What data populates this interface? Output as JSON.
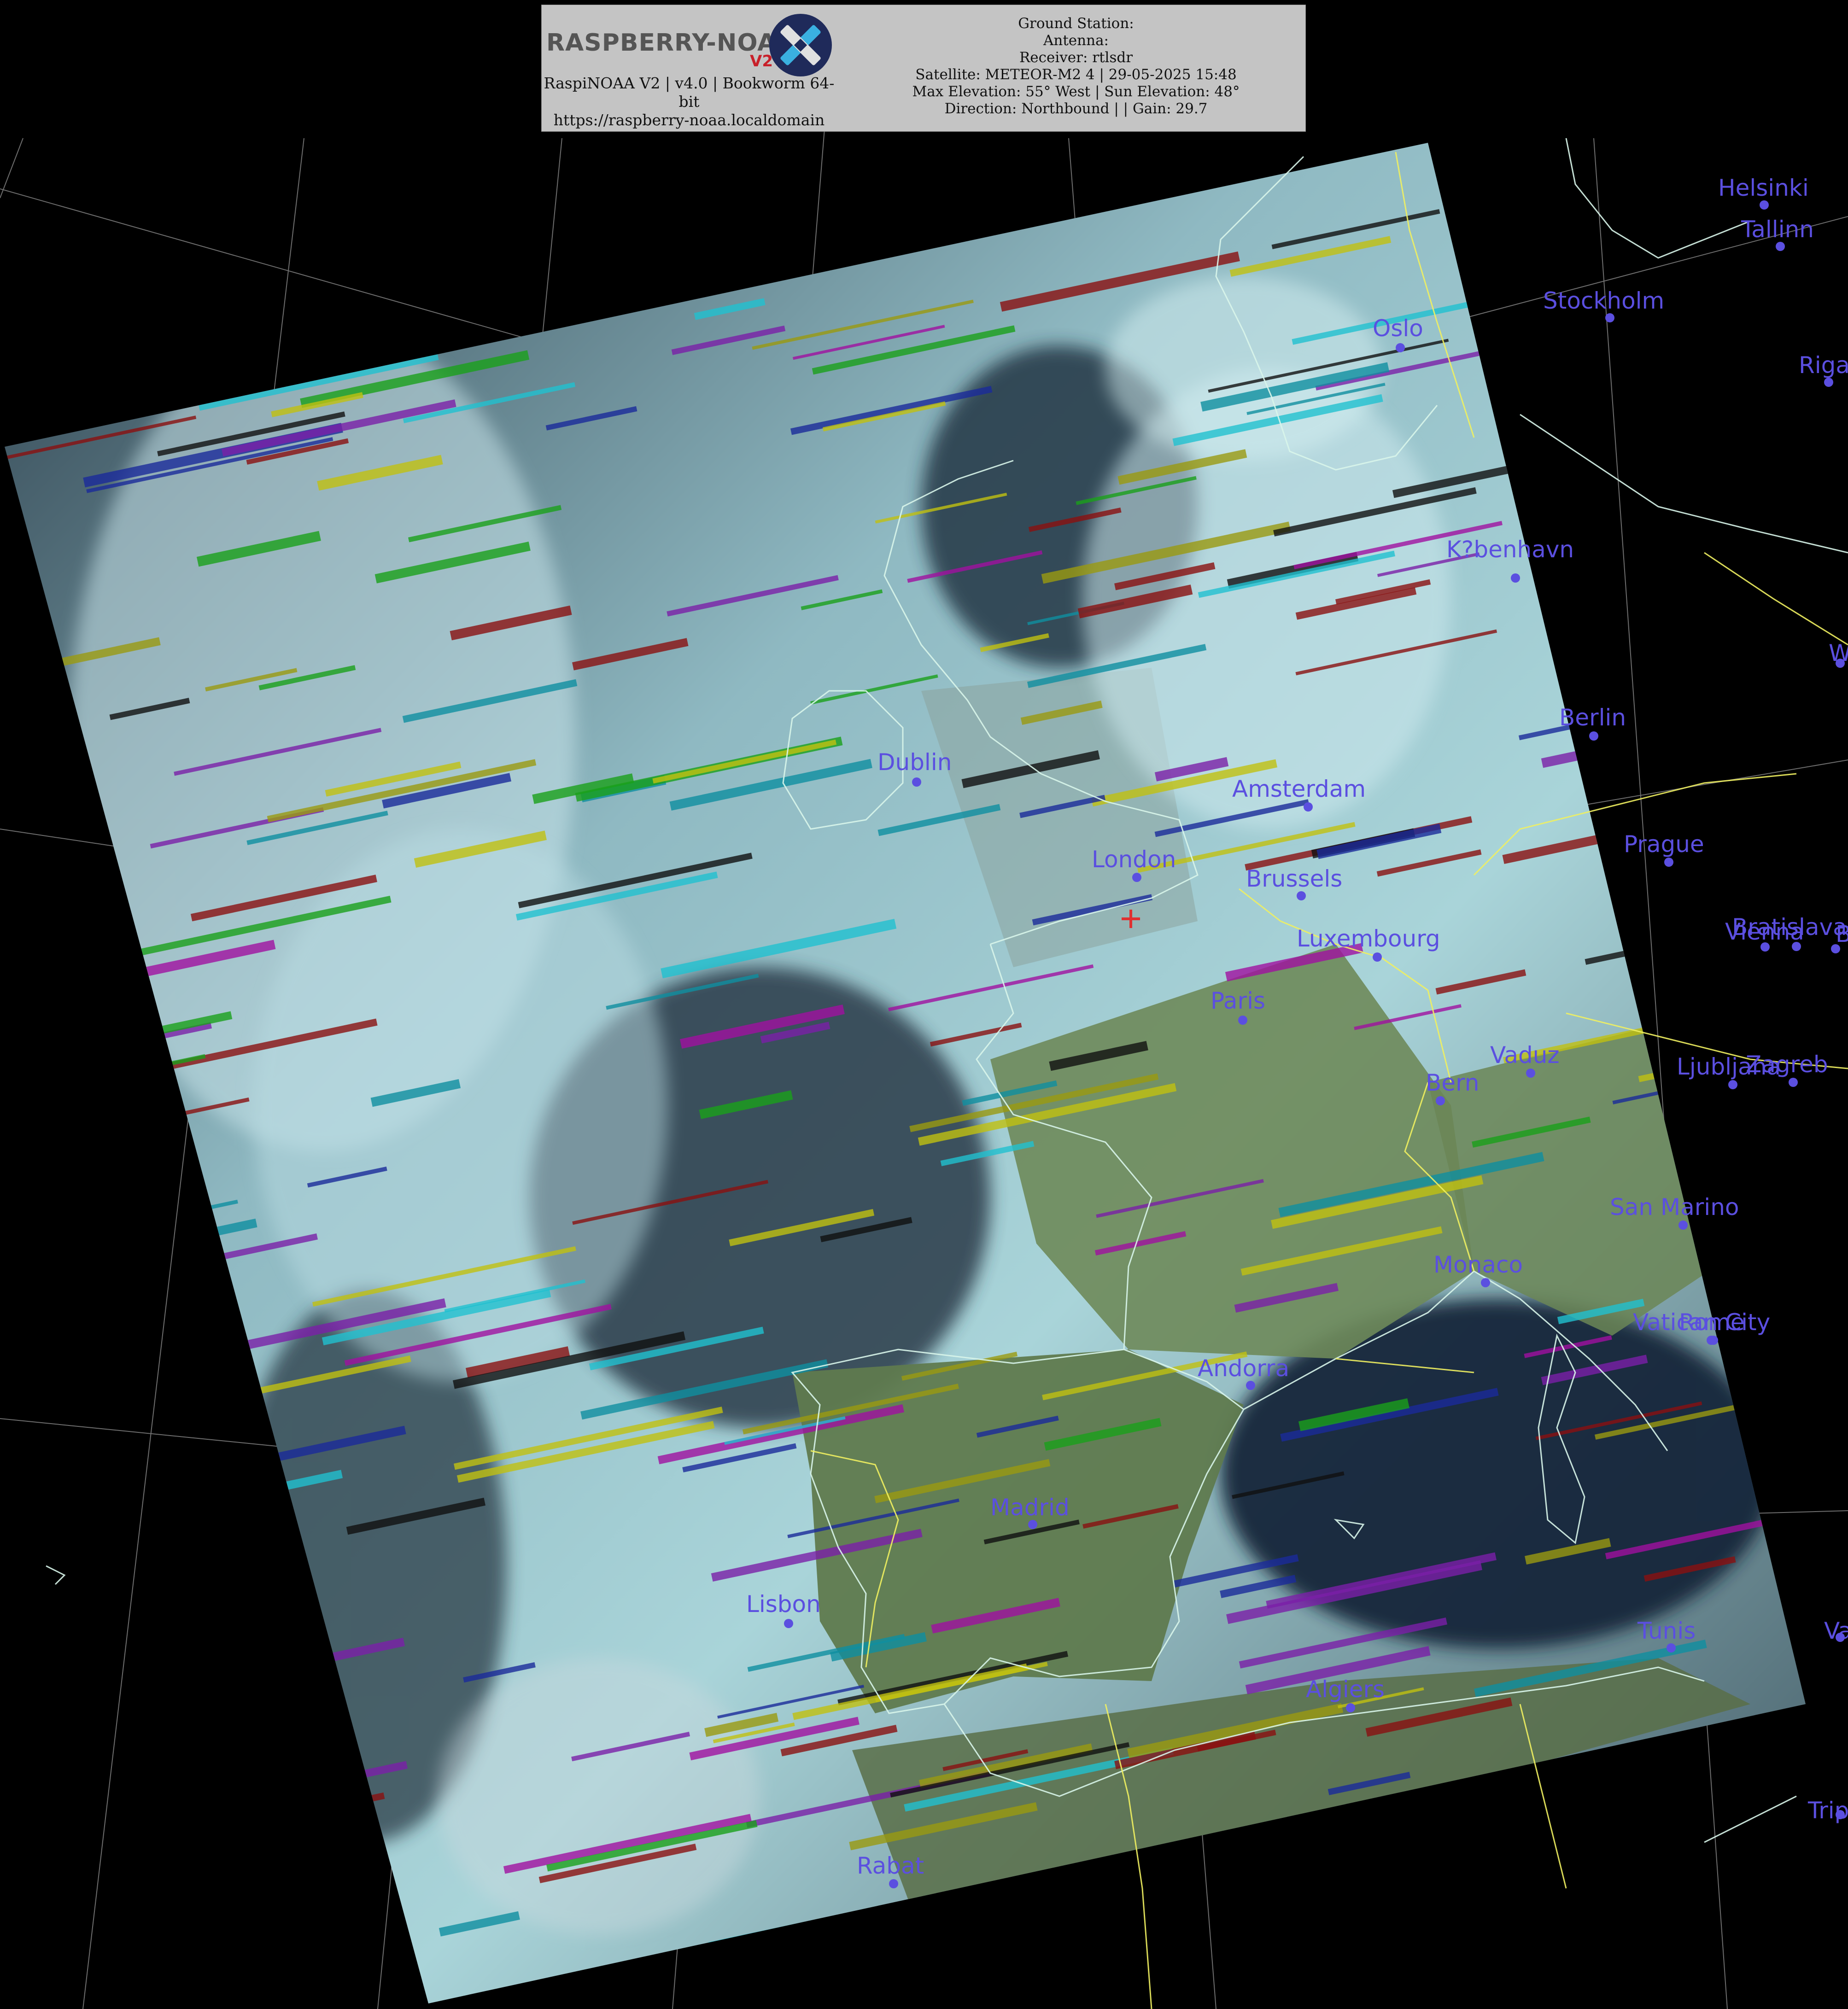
{
  "header": {
    "logo_text": "RASPBERRY-NOAA",
    "logo_v2": "V2",
    "left_lines": [
      "RaspiNOAA V2 | v4.0 | Bookworm 64-",
      "bit",
      "https://raspberry-noaa.localdomain"
    ],
    "right_lines": [
      "Ground Station:",
      "Antenna:",
      "Receiver: rtlsdr",
      "Satellite: METEOR-M2 4 | 29-05-2025 15:48",
      "Max Elevation: 55° West | Sun Elevation: 48°",
      "Direction: Northbound | | Gain: 29.7"
    ]
  },
  "cities": [
    {
      "name": "Helsinki"
    },
    {
      "name": "Tallinn"
    },
    {
      "name": "Stockholm"
    },
    {
      "name": "Oslo"
    },
    {
      "name": "Riga"
    },
    {
      "name": "K?benhavn"
    },
    {
      "name": "Warsaw"
    },
    {
      "name": "Berlin"
    },
    {
      "name": "Dublin"
    },
    {
      "name": "Amsterdam"
    },
    {
      "name": "London"
    },
    {
      "name": "Brussels"
    },
    {
      "name": "Prague"
    },
    {
      "name": "Luxembourg"
    },
    {
      "name": "Bratislava"
    },
    {
      "name": "Vienna"
    },
    {
      "name": "Budapest"
    },
    {
      "name": "Paris"
    },
    {
      "name": "Vaduz"
    },
    {
      "name": "Bern"
    },
    {
      "name": "Ljubljana"
    },
    {
      "name": "Zagreb"
    },
    {
      "name": "San Marino"
    },
    {
      "name": "Monaco"
    },
    {
      "name": "Vatican City"
    },
    {
      "name": "Rome"
    },
    {
      "name": "Andorra"
    },
    {
      "name": "Madrid"
    },
    {
      "name": "Lisbon"
    },
    {
      "name": "Tunis"
    },
    {
      "name": "Valletta"
    },
    {
      "name": "Algiers"
    },
    {
      "name": "Rabat"
    },
    {
      "name": "Tripoli"
    }
  ],
  "colors": {
    "city": "#5b4fe0",
    "coast": "#d8f5ea",
    "border": "#f0f060",
    "grid": "#8a8a8a",
    "station_marker": "#e03030"
  }
}
